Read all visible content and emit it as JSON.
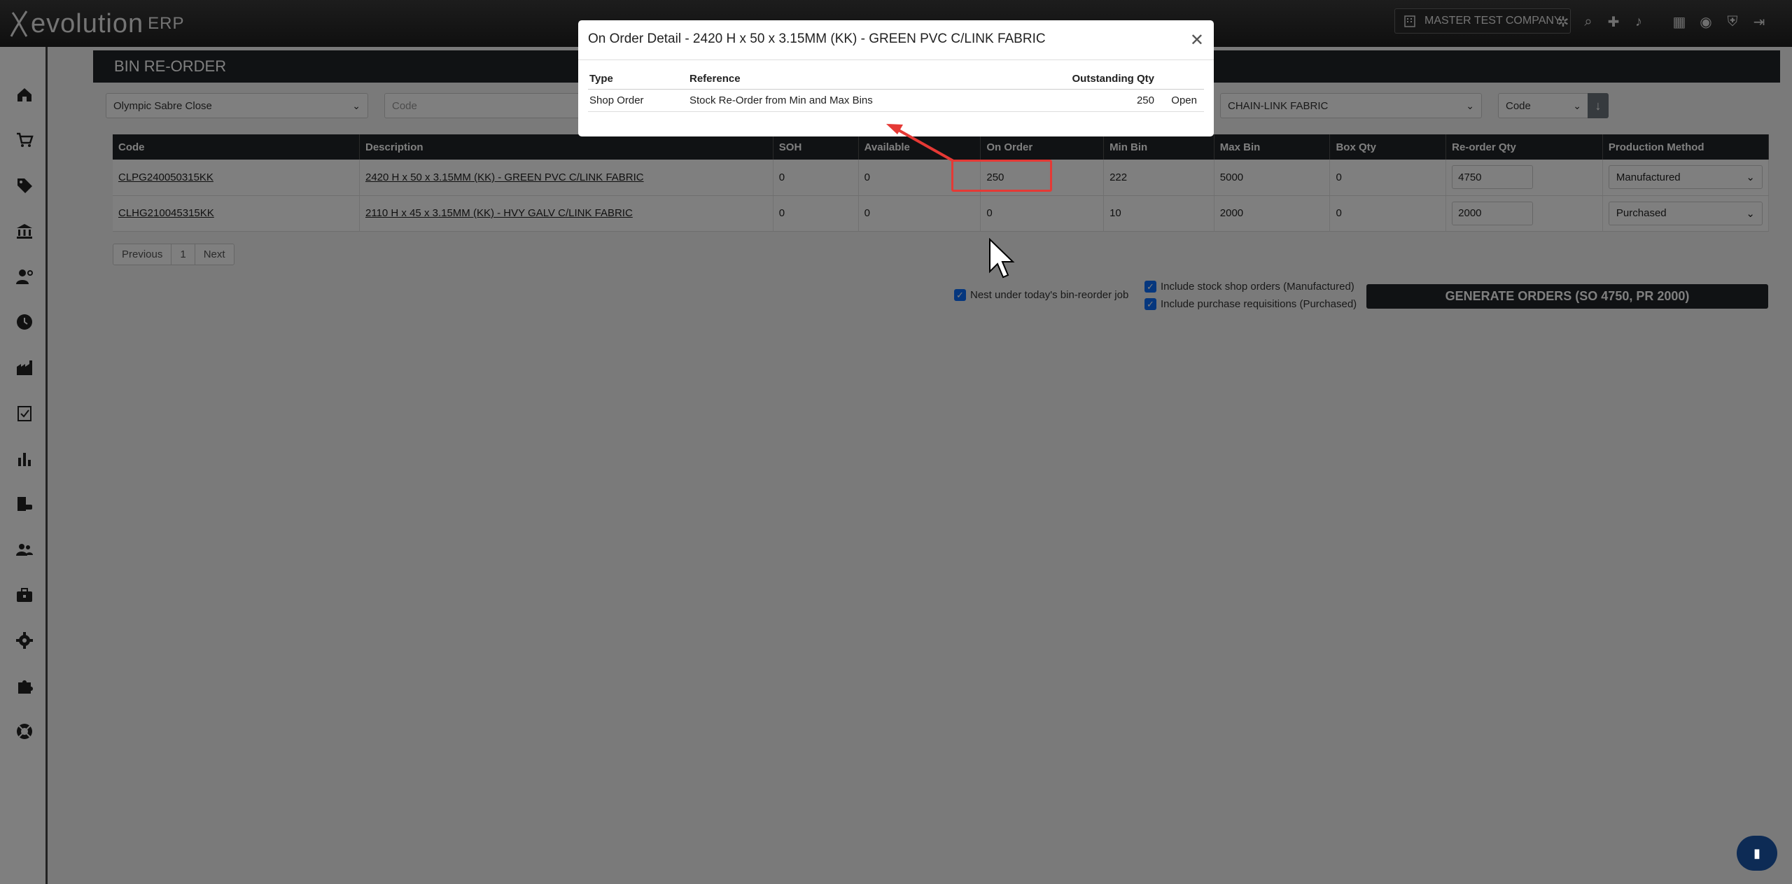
{
  "app": {
    "logo_text": "evolution",
    "logo_erp": "ERP",
    "company": "MASTER TEST COMPANY"
  },
  "page": {
    "title": "BIN RE-ORDER"
  },
  "filters": {
    "site": "Olympic Sabre Close",
    "code_placeholder": "Code",
    "category": "CHAIN-LINK FABRIC",
    "sort_by": "Code"
  },
  "table": {
    "headers": [
      "Code",
      "Description",
      "SOH",
      "Available",
      "On Order",
      "Min Bin",
      "Max Bin",
      "Box Qty",
      "Re-order Qty",
      "Production Method"
    ],
    "rows": [
      {
        "code": "CLPG240050315KK",
        "description": "2420 H x 50 x 3.15MM (KK) - GREEN PVC C/LINK FABRIC",
        "soh": "0",
        "available": "0",
        "on_order": "250",
        "min_bin": "222",
        "max_bin": "5000",
        "box_qty": "0",
        "reorder_qty": "4750",
        "method": "Manufactured"
      },
      {
        "code": "CLHG210045315KK",
        "description": "2110 H x 45 x 3.15MM (KK) - HVY GALV C/LINK FABRIC",
        "soh": "0",
        "available": "0",
        "on_order": "0",
        "min_bin": "10",
        "max_bin": "2000",
        "box_qty": "0",
        "reorder_qty": "2000",
        "method": "Purchased"
      }
    ]
  },
  "pagination": {
    "previous": "Previous",
    "page": "1",
    "next": "Next"
  },
  "options": {
    "nest": "Nest under today's bin-reorder job",
    "include_shop": "Include stock shop orders (Manufactured)",
    "include_purchase": "Include purchase requisitions (Purchased)",
    "generate": "GENERATE ORDERS (SO 4750, PR 2000)"
  },
  "modal": {
    "title": "On Order Detail - 2420 H x 50 x 3.15MM (KK) - GREEN PVC C/LINK FABRIC",
    "headers": {
      "type": "Type",
      "reference": "Reference",
      "qty": "Outstanding Qty"
    },
    "row": {
      "type": "Shop Order",
      "reference": "Stock Re-Order from Min and Max Bins",
      "qty": "250",
      "action": "Open"
    }
  },
  "colors": {
    "accent": "#0d6efd",
    "annotation": "#e53935",
    "header": "#212529"
  }
}
